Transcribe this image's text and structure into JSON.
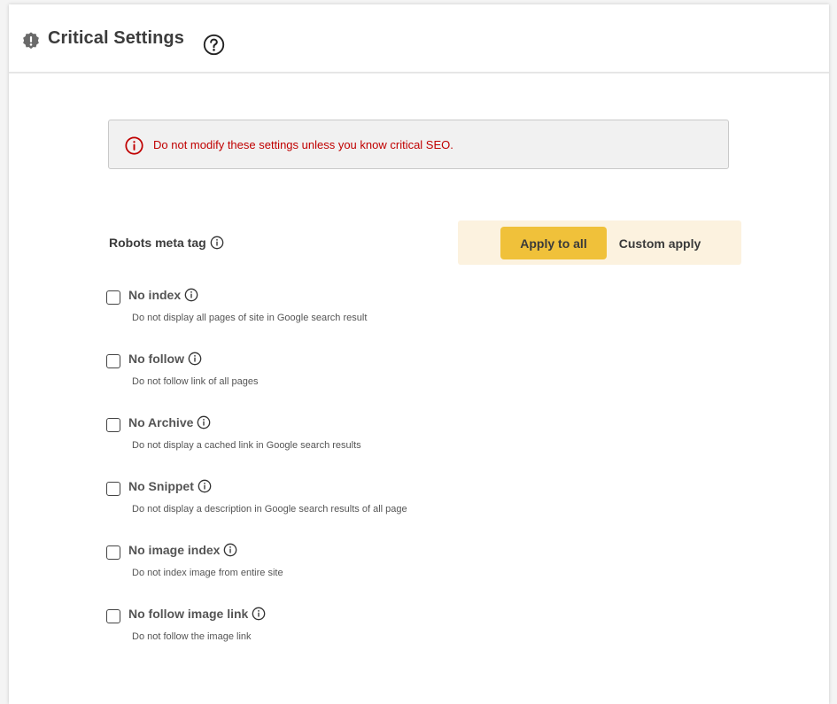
{
  "header": {
    "title": "Critical Settings"
  },
  "warning": {
    "text": "Do not modify these settings unless you know critical SEO."
  },
  "robots": {
    "label": "Robots meta tag",
    "apply_all_label": "Apply to all",
    "custom_apply_label": "Custom apply",
    "active_mode": "Apply to all"
  },
  "options": [
    {
      "title": "No index",
      "desc": "Do not display all pages of site in Google search result",
      "checked": false
    },
    {
      "title": "No follow",
      "desc": "Do not follow link of all pages",
      "checked": false
    },
    {
      "title": "No Archive",
      "desc": "Do not display a cached link in Google search results",
      "checked": false
    },
    {
      "title": "No Snippet",
      "desc": "Do not display a description in Google search results of all page",
      "checked": false
    },
    {
      "title": "No image index",
      "desc": "Do not index image from entire site",
      "checked": false
    },
    {
      "title": "No follow image link",
      "desc": "Do not follow the image link",
      "checked": false
    }
  ],
  "colors": {
    "accent": "#f0c13a",
    "toggle_bg": "#fcf2df",
    "warning_text": "#c00000",
    "warning_bg": "#f1f1f1"
  },
  "icons": {
    "header": "alert-badge-icon",
    "help": "question-circle-icon",
    "warning": "info-circle-icon",
    "info": "info-circle-icon"
  }
}
